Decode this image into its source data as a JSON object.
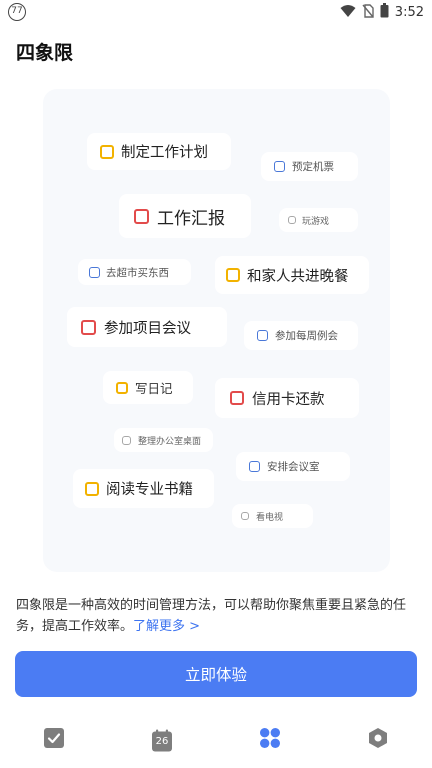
{
  "status_bar": {
    "notification_count": "77",
    "time": "3:52",
    "icons": [
      "wifi-icon",
      "no-sim-icon",
      "battery-icon"
    ]
  },
  "page": {
    "title": "四象限"
  },
  "tasks": [
    {
      "label": "制定工作计划",
      "checkbox_color": "yellow"
    },
    {
      "label": "预定机票",
      "checkbox_color": "blue"
    },
    {
      "label": "工作汇报",
      "checkbox_color": "red"
    },
    {
      "label": "玩游戏",
      "checkbox_color": "gray"
    },
    {
      "label": "去超市买东西",
      "checkbox_color": "blue"
    },
    {
      "label": "和家人共进晚餐",
      "checkbox_color": "yellow"
    },
    {
      "label": "参加项目会议",
      "checkbox_color": "red"
    },
    {
      "label": "参加每周例会",
      "checkbox_color": "blue"
    },
    {
      "label": "写日记",
      "checkbox_color": "yellow"
    },
    {
      "label": "信用卡还款",
      "checkbox_color": "red"
    },
    {
      "label": "整理办公室桌面",
      "checkbox_color": "gray"
    },
    {
      "label": "安排会议室",
      "checkbox_color": "blue"
    },
    {
      "label": "阅读专业书籍",
      "checkbox_color": "yellow"
    },
    {
      "label": "看电视",
      "checkbox_color": "gray"
    }
  ],
  "description": {
    "text": "四象限是一种高效的时间管理方法，可以帮助你聚焦重要且紧急的任务，提高工作效率。",
    "link_text": "了解更多 >"
  },
  "cta": {
    "label": "立即体验"
  },
  "tabbar": {
    "calendar_day": "26",
    "active_tab": "quadrant",
    "icons": [
      "todo-check-icon",
      "calendar-icon",
      "quadrant-icon",
      "hexagon-settings-icon"
    ]
  },
  "colors": {
    "accent": "#4b7cf3",
    "link": "#3e74f0",
    "yellow": "#f2b200",
    "red": "#e24b4b",
    "blue": "#4a78d8",
    "gray": "#a8a8a8"
  }
}
